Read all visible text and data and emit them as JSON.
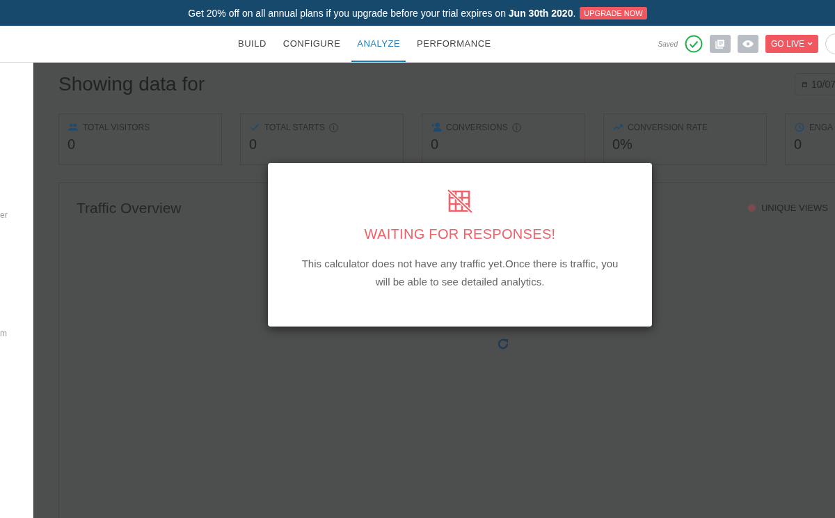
{
  "banner": {
    "text": "Get 20% off on all annual plans if you upgrade before your trial expires on **Jun 30th 2020**.",
    "button": "UPGRADE NOW"
  },
  "nav": {
    "tabs": [
      {
        "label": "BUILD",
        "selected": false
      },
      {
        "label": "CONFIGURE",
        "selected": false
      },
      {
        "label": "ANALYZE",
        "selected": true
      },
      {
        "label": "PERFORMANCE",
        "selected": false
      }
    ],
    "saved": "Saved",
    "go_live": "GO LIVE"
  },
  "sidebar": {
    "items": [
      "er",
      "m"
    ]
  },
  "page": {
    "title": "Showing data for",
    "date": "10/07"
  },
  "stats": [
    {
      "label": "TOTAL VISITORS",
      "value": "0",
      "info": false
    },
    {
      "label": "TOTAL STARTS",
      "value": "0",
      "info": true
    },
    {
      "label": "CONVERSIONS",
      "value": "0",
      "info": true
    },
    {
      "label": "CONVERSION RATE",
      "value": "0%",
      "info": false
    },
    {
      "label": "ENGA",
      "value": "0",
      "info": false
    }
  ],
  "traffic": {
    "title": "Traffic Overview",
    "legend": [
      {
        "label": "UNIQUE VIEWS",
        "color": "#7a4a4e"
      }
    ]
  },
  "modal": {
    "title": "WAITING FOR RESPONSES!",
    "message": "This calculator does not have any traffic yet.Once there is traffic, you will be able to see detailed analytics."
  }
}
